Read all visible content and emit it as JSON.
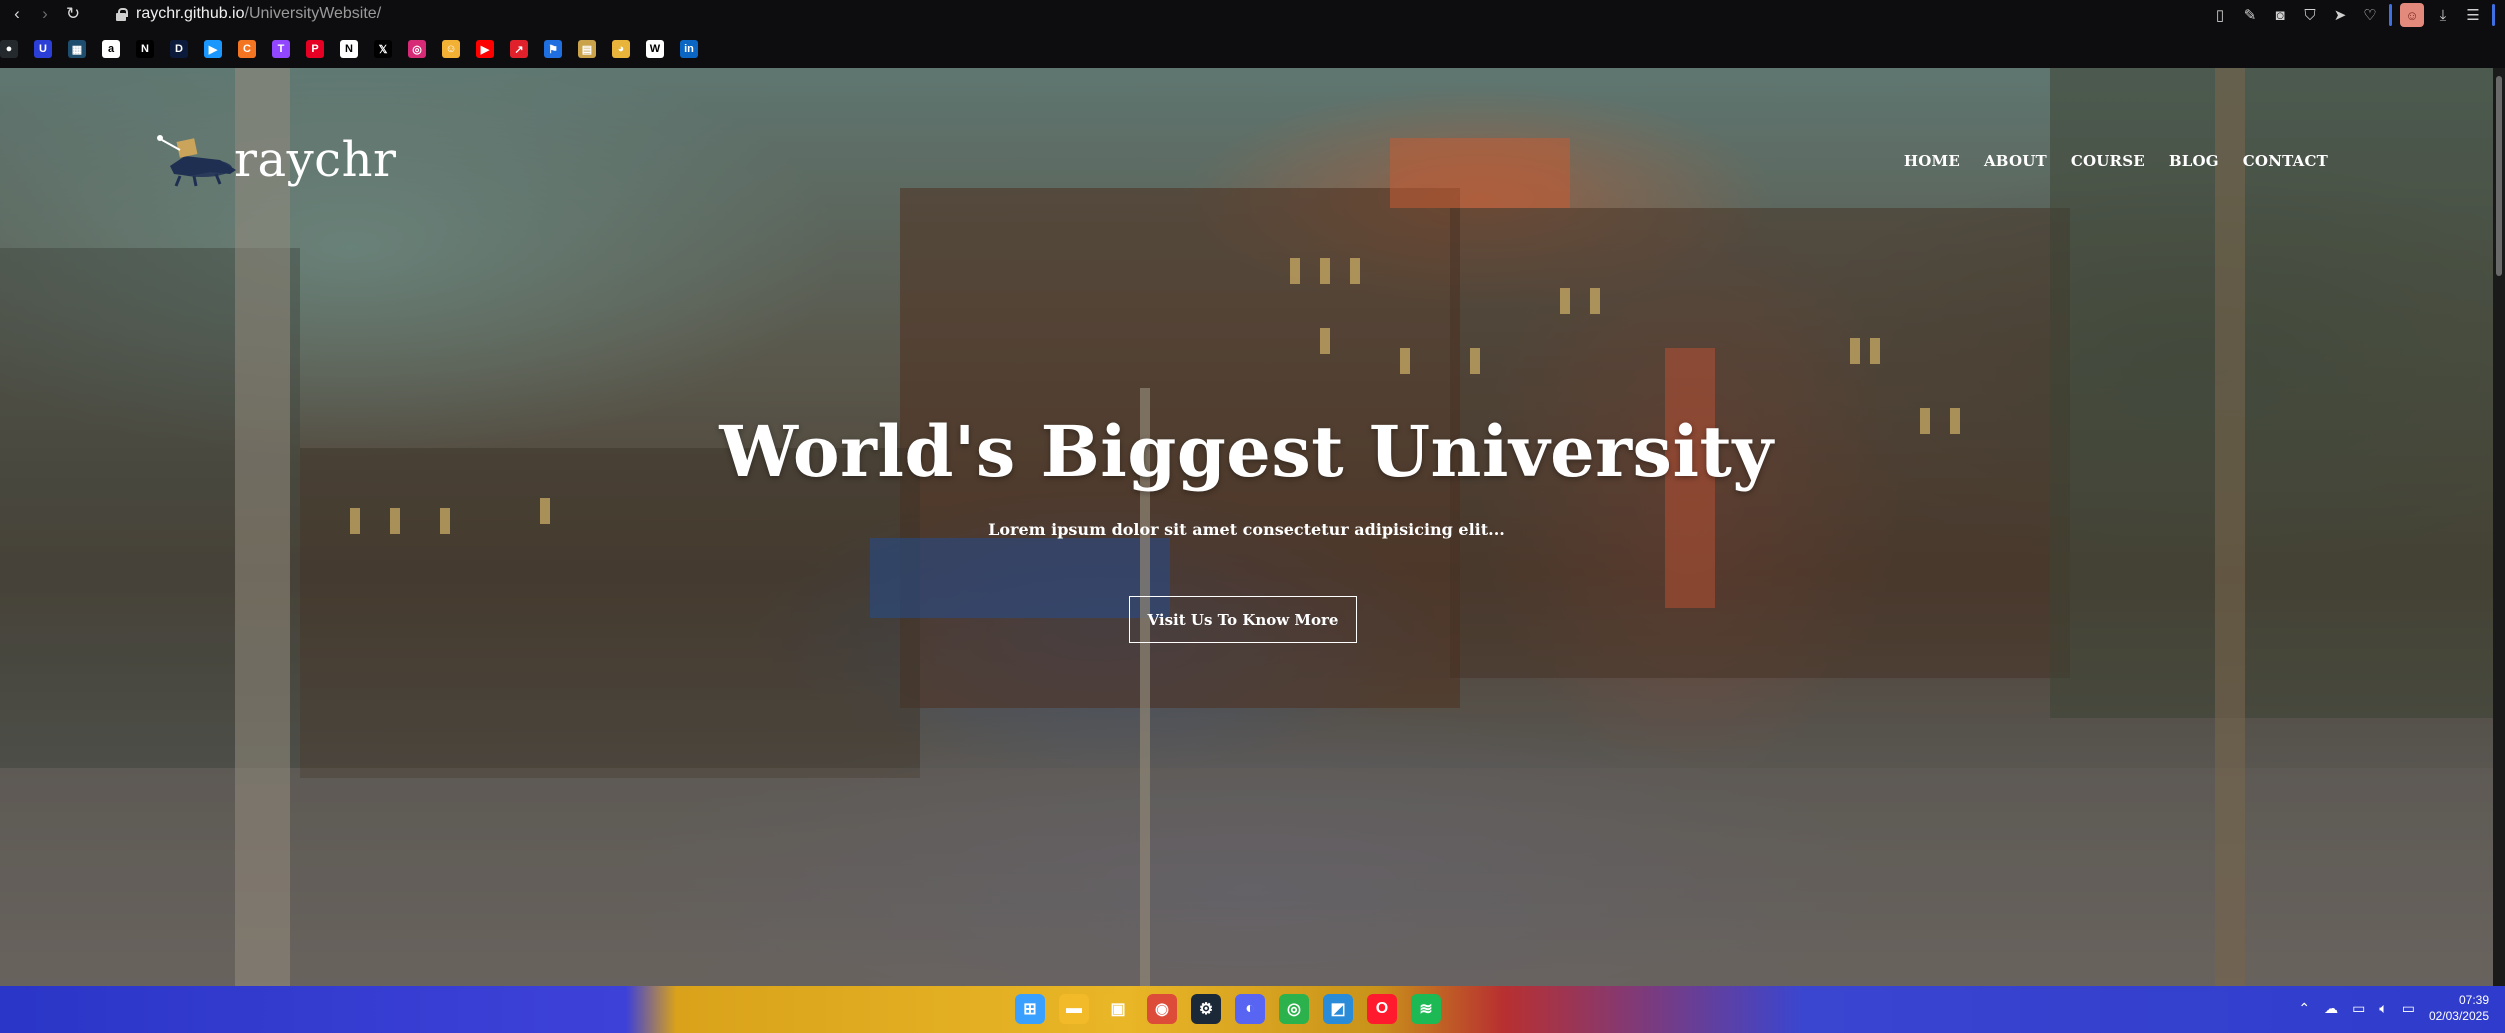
{
  "browser": {
    "url_domain": "raychr.github.io",
    "url_path": "/UniversityWebsite/",
    "bookmarks": [
      {
        "icon": "github-icon",
        "color": "#24292e",
        "glyph": "●"
      },
      {
        "icon": "u-brand-icon",
        "color": "#2b3fd6",
        "glyph": "U"
      },
      {
        "icon": "calendar-icon",
        "color": "#1f4d6e",
        "glyph": "▦"
      },
      {
        "icon": "amazon-icon",
        "color": "#ffffff",
        "glyph": "a"
      },
      {
        "icon": "netflix-icon",
        "color": "#000000",
        "glyph": "N"
      },
      {
        "icon": "disney-icon",
        "color": "#0b1a3a",
        "glyph": "D"
      },
      {
        "icon": "prime-video-icon",
        "color": "#1a98ff",
        "glyph": "▶"
      },
      {
        "icon": "crunchyroll-icon",
        "color": "#f47521",
        "glyph": "C"
      },
      {
        "icon": "twitch-icon",
        "color": "#9146ff",
        "glyph": "T"
      },
      {
        "icon": "pinterest-icon",
        "color": "#e60023",
        "glyph": "P"
      },
      {
        "icon": "notion-icon",
        "color": "#ffffff",
        "glyph": "N"
      },
      {
        "icon": "x-icon",
        "color": "#000000",
        "glyph": "𝕏"
      },
      {
        "icon": "instagram-icon",
        "color": "#d62976",
        "glyph": "◎"
      },
      {
        "icon": "bookmark-yellow-icon",
        "color": "#f2b134",
        "glyph": "☺"
      },
      {
        "icon": "youtube-icon",
        "color": "#ff0000",
        "glyph": "▶"
      },
      {
        "icon": "app-red-icon",
        "color": "#e0202b",
        "glyph": "↗"
      },
      {
        "icon": "flag-icon",
        "color": "#1f6fe0",
        "glyph": "⚑"
      },
      {
        "icon": "folder-app-icon",
        "color": "#c9a24a",
        "glyph": "▤"
      },
      {
        "icon": "emoji-icon",
        "color": "#e8b43a",
        "glyph": "◕"
      },
      {
        "icon": "wix-icon",
        "color": "#ffffff",
        "glyph": "W"
      },
      {
        "icon": "linkedin-icon",
        "color": "#0a66c2",
        "glyph": "in"
      }
    ],
    "tools": [
      "reader-icon",
      "edit-icon",
      "camera-icon",
      "shield-icon",
      "send-icon",
      "heart-icon",
      "divider",
      "avatar-icon",
      "download-icon",
      "menu-icon",
      "divider"
    ]
  },
  "site": {
    "logo_text": "raychr",
    "nav": [
      "HOME",
      "ABOUT",
      "COURSE",
      "BLOG",
      "CONTACT"
    ],
    "hero_title": "World's Biggest University",
    "hero_subtitle": "Lorem ipsum dolor sit amet consectetur adipisicing elit...",
    "hero_button": "Visit Us To Know More"
  },
  "taskbar": {
    "apps": [
      {
        "icon": "windows-start-icon",
        "color": "#3aa0ff",
        "glyph": "⊞"
      },
      {
        "icon": "file-explorer-icon",
        "color": "#f2b928",
        "glyph": "▬"
      },
      {
        "icon": "store-icon",
        "color": "#e9b627",
        "glyph": "▣"
      },
      {
        "icon": "chrome-icon",
        "color": "#dd4b39",
        "glyph": "◉"
      },
      {
        "icon": "steam-icon",
        "color": "#1b2838",
        "glyph": "⚙"
      },
      {
        "icon": "discord-icon",
        "color": "#5865f2",
        "glyph": "◐"
      },
      {
        "icon": "chrome-canary-icon",
        "color": "#2bb24c",
        "glyph": "◎"
      },
      {
        "icon": "app-blue-icon",
        "color": "#2a8bd8",
        "glyph": "◩"
      },
      {
        "icon": "opera-icon",
        "color": "#ff1b2d",
        "glyph": "O"
      },
      {
        "icon": "spotify-icon",
        "color": "#1db954",
        "glyph": "≋"
      }
    ],
    "tray": [
      "chevron-up-icon",
      "onedrive-icon",
      "network-icon",
      "volume-icon",
      "battery-icon"
    ],
    "time": "07:39",
    "date": "02/03/2025"
  }
}
